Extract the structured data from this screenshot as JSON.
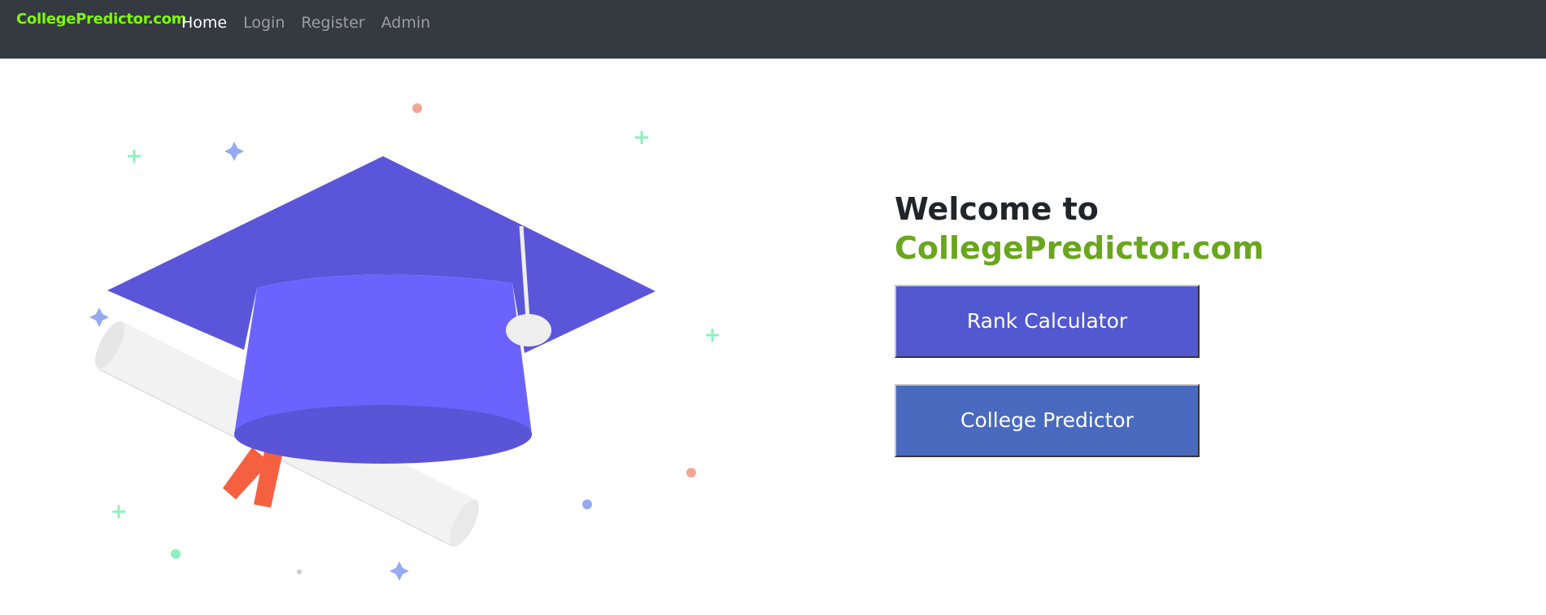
{
  "navbar": {
    "brand": "CollegePredictor.com",
    "links": [
      {
        "label": "Home",
        "active": true
      },
      {
        "label": "Login",
        "active": false
      },
      {
        "label": "Register",
        "active": false
      },
      {
        "label": "Admin",
        "active": false
      }
    ]
  },
  "hero": {
    "welcome_line": "Welcome to",
    "site_name": "CollegePredictor.com",
    "buttons": {
      "rank_calculator": "Rank Calculator",
      "college_predictor": "College Predictor"
    }
  },
  "illustration": {
    "subject": "graduation-cap-with-diploma",
    "colors": {
      "cap_top": "#5b56d9",
      "cap_body": "#6c63ff",
      "cap_bottom": "#5a54d6",
      "tassel": "#eeeeee",
      "diploma": "#f2f2f2",
      "ribbon": "#f56040"
    }
  },
  "colors": {
    "navbar_bg": "#343a40",
    "brand": "#7cfc00",
    "site_name": "#6aa61d",
    "rank_button": "#5258cf",
    "college_button": "#4a6abf"
  }
}
